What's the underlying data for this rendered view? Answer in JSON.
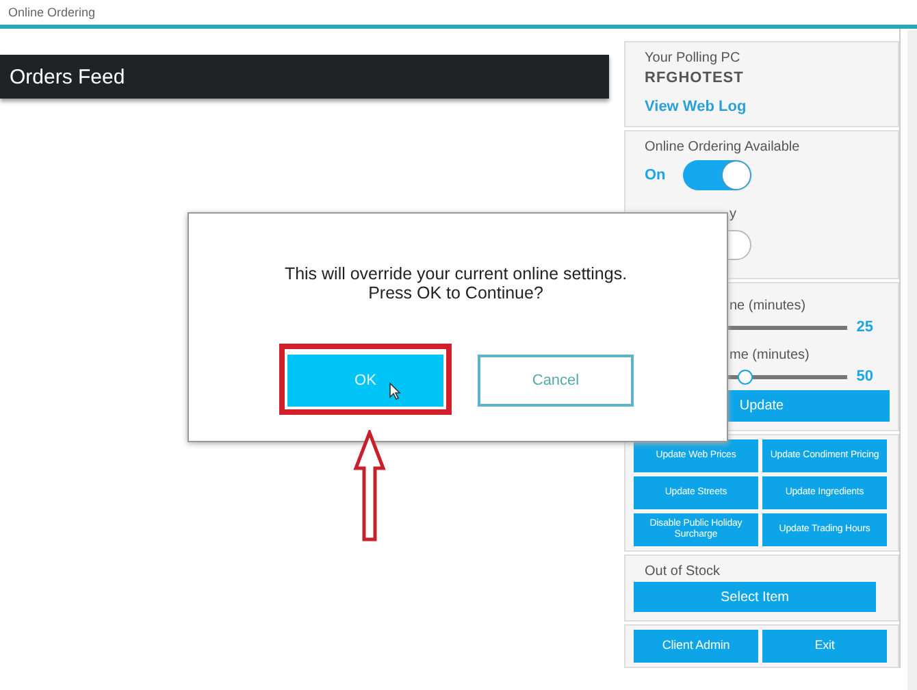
{
  "window": {
    "title": "Online Ordering"
  },
  "orders_feed": {
    "title": "Orders Feed"
  },
  "side_panel": {
    "polling": {
      "label": "Your Polling PC",
      "value": "RFGHOTEST",
      "link": "View Web Log"
    },
    "toggles": [
      {
        "label": "Online Ordering Available",
        "state_label": "On",
        "on": true
      },
      {
        "label": "y",
        "on": false
      }
    ],
    "sliders": [
      {
        "label": "ne (minutes)",
        "reading": "25"
      },
      {
        "label": "me (minutes)",
        "level": 0.49,
        "reading": "50"
      }
    ],
    "update_button": "Update",
    "actions": [
      "Update Web Prices",
      "Update Condiment Pricing",
      "Update Streets",
      "Update Ingredients",
      "Disable Public Holiday Surcharge",
      "Update Trading Hours"
    ],
    "out_of_stock": {
      "label": "Out of Stock",
      "button": "Select Item"
    },
    "footer_buttons": [
      "Client Admin",
      "Exit"
    ]
  },
  "dialog": {
    "message_lines": [
      "This will override your current online settings.",
      "Press OK to Continue?"
    ],
    "buttons": [
      {
        "label": "OK",
        "kind": "primary",
        "annotated": true
      },
      {
        "label": "Cancel",
        "kind": "secondary",
        "annotated": false
      }
    ]
  }
}
